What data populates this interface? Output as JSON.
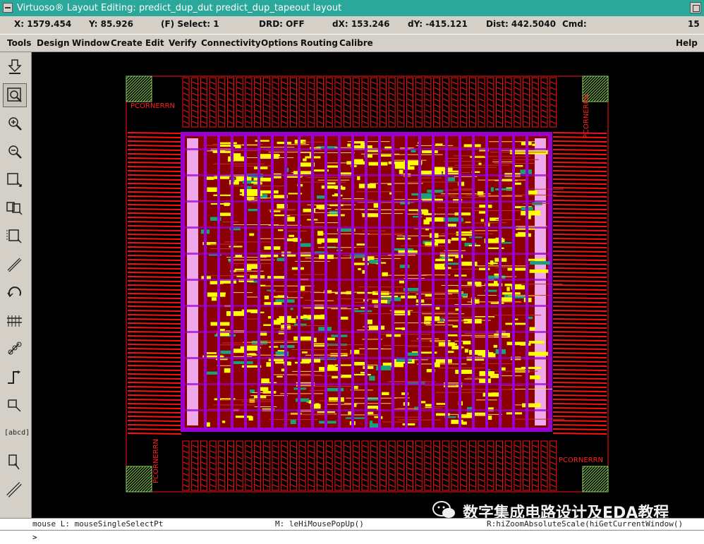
{
  "window": {
    "title": "Virtuoso® Layout Editing: predict_dup_dut predict_dup_tapeout layout"
  },
  "status": {
    "x": "X: 1579.454",
    "y": "Y: 85.926",
    "select": "(F) Select: 1",
    "drd": "DRD: OFF",
    "dx": "dX: 153.246",
    "dy": "dY: -415.121",
    "dist": "Dist: 442.5040",
    "cmd": "Cmd:",
    "count": "15"
  },
  "menu": {
    "items": [
      "Tools",
      "Design",
      "Window",
      "Create",
      "Edit",
      "Verify",
      "Connectivity",
      "Options",
      "Routing",
      "Calibre"
    ],
    "help": "Help"
  },
  "toolbar": {
    "tools": [
      "save-icon",
      "zoom-fit-icon",
      "zoom-in-icon",
      "zoom-out-icon",
      "stretch-icon",
      "copy-icon",
      "move-icon",
      "path-icon",
      "undo-icon",
      "measure-icon",
      "property-icon",
      "route-icon",
      "reshape-icon",
      "label-icon",
      "select-icon",
      "ruler-icon"
    ],
    "label_tool_text": "[abcd]"
  },
  "layout": {
    "corner_labels": [
      "PCORNERRN",
      "PCORNERRN",
      "PCORNERRN",
      "PCORNERRN"
    ],
    "colors": {
      "background": "#000000",
      "pad": "#ff1010",
      "core": "#8b0000",
      "strap": "#9a00d0",
      "cell": "#ffff00",
      "via": "#1aa07a",
      "corner": "#8ed060",
      "ring": "#f0a8ec"
    }
  },
  "cmd": {
    "mouse_l": "mouse L: mouseSingleSelectPt",
    "mouse_m": "M: leHiMousePopUp()",
    "mouse_r": "R:hiZoomAbsoluteScale(hiGetCurrentWindow()"
  },
  "prompt": ">",
  "watermark": {
    "text": "数字集成电路设计及EDA教程"
  }
}
